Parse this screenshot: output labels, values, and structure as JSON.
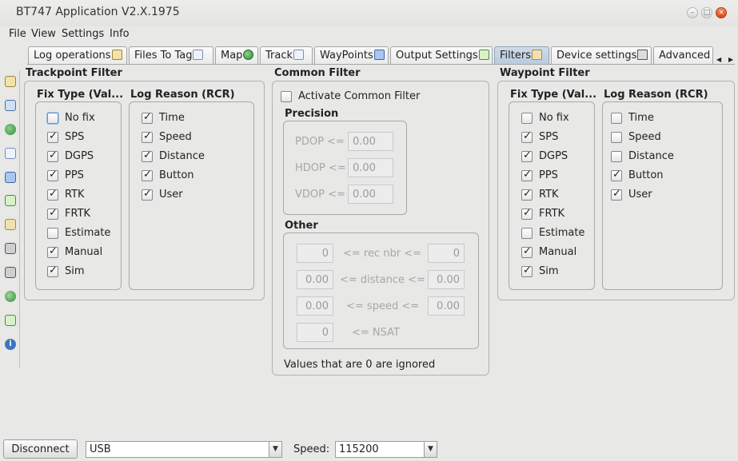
{
  "window": {
    "title": "BT747 Application V2.X.1975"
  },
  "menu": [
    "File",
    "View",
    "Settings",
    "Info"
  ],
  "tabs": [
    {
      "label": "Log operations",
      "icon": "home-icon"
    },
    {
      "label": "Files To Tag",
      "icon": "files-icon"
    },
    {
      "label": "Map",
      "icon": "globe-icon"
    },
    {
      "label": "Track",
      "icon": "track-doc-icon"
    },
    {
      "label": "WayPoints",
      "icon": "waypoint-flag-icon"
    },
    {
      "label": "Output Settings",
      "icon": "output-arrow-icon"
    },
    {
      "label": "Filters",
      "icon": "hourglass-icon",
      "selected": true
    },
    {
      "label": "Device settings",
      "icon": "wrench-icon"
    },
    {
      "label": "Advanced"
    }
  ],
  "trackpoint_filter": {
    "title": "Trackpoint Filter",
    "fix_title": "Fix Type (Val...",
    "fix": [
      {
        "label": "No fix",
        "checked": false
      },
      {
        "label": "SPS",
        "checked": true
      },
      {
        "label": "DGPS",
        "checked": true
      },
      {
        "label": "PPS",
        "checked": true
      },
      {
        "label": "RTK",
        "checked": true
      },
      {
        "label": "FRTK",
        "checked": true
      },
      {
        "label": "Estimate",
        "checked": false
      },
      {
        "label": "Manual",
        "checked": true
      },
      {
        "label": "Sim",
        "checked": true
      }
    ],
    "reason_title": "Log Reason (RCR)",
    "reason": [
      {
        "label": "Time",
        "checked": true
      },
      {
        "label": "Speed",
        "checked": true
      },
      {
        "label": "Distance",
        "checked": true
      },
      {
        "label": "Button",
        "checked": true
      },
      {
        "label": "User",
        "checked": true
      }
    ]
  },
  "common_filter": {
    "title": "Common Filter",
    "activate_label": "Activate Common Filter",
    "activate_checked": false,
    "precision_title": "Precision",
    "pdop_label": "PDOP <=",
    "pdop_value": "0.00",
    "hdop_label": "HDOP <=",
    "hdop_value": "0.00",
    "vdop_label": "VDOP <=",
    "vdop_value": "0.00",
    "other_title": "Other",
    "rec_min": "0",
    "rec_label": "<= rec nbr <=",
    "rec_max": "0",
    "dist_min": "0.00",
    "dist_label": "<= distance <=",
    "dist_max": "0.00",
    "speed_min": "0.00",
    "speed_label": "<= speed <=",
    "speed_max": "0.00",
    "nsat_min": "0",
    "nsat_label": "<= NSAT",
    "note": "Values that are 0 are ignored"
  },
  "waypoint_filter": {
    "title": "Waypoint Filter",
    "fix_title": "Fix Type (Val...",
    "fix": [
      {
        "label": "No fix",
        "checked": false
      },
      {
        "label": "SPS",
        "checked": true
      },
      {
        "label": "DGPS",
        "checked": true
      },
      {
        "label": "PPS",
        "checked": true
      },
      {
        "label": "RTK",
        "checked": true
      },
      {
        "label": "FRTK",
        "checked": true
      },
      {
        "label": "Estimate",
        "checked": false
      },
      {
        "label": "Manual",
        "checked": true
      },
      {
        "label": "Sim",
        "checked": true
      }
    ],
    "reason_title": "Log Reason (RCR)",
    "reason": [
      {
        "label": "Time",
        "checked": false
      },
      {
        "label": "Speed",
        "checked": false
      },
      {
        "label": "Distance",
        "checked": false
      },
      {
        "label": "Button",
        "checked": true
      },
      {
        "label": "User",
        "checked": true
      }
    ]
  },
  "bottom": {
    "disconnect_label": "Disconnect",
    "port_value": "USB",
    "speed_label": "Speed:",
    "speed_value": "115200"
  },
  "sidebar_icons": [
    "home-icon",
    "files-icon",
    "globe-icon",
    "track-doc-icon",
    "waypoint-flag-icon",
    "output-arrow-icon",
    "hourglass-icon",
    "wrench-icon",
    "wrench-plus-icon",
    "globe-refresh-icon",
    "export-arrow-icon",
    "info-icon"
  ],
  "colors": {
    "selected_tab": "#c3d3e5",
    "window_bg": "#e8e8e7",
    "close_button": "#e2562a"
  }
}
